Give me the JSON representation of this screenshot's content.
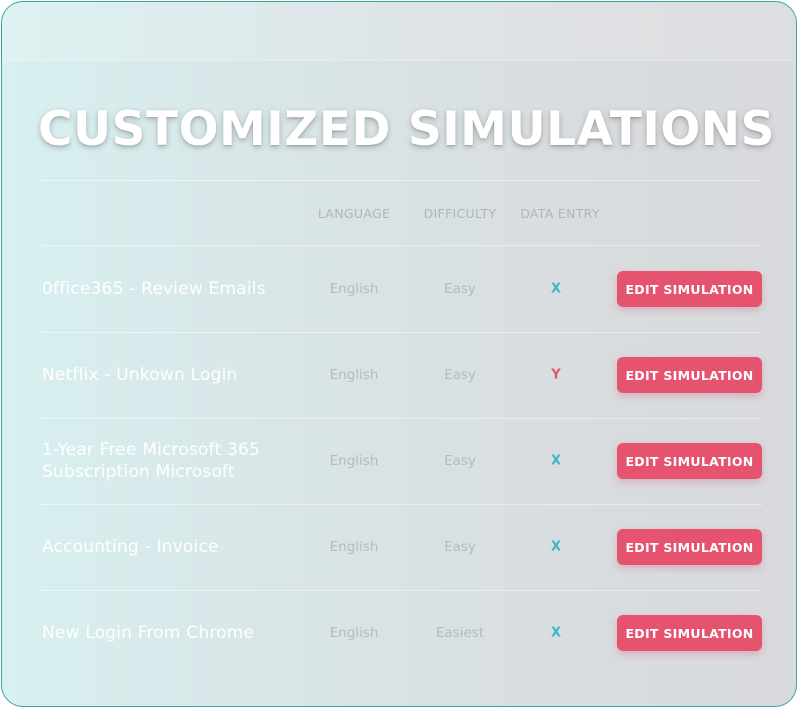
{
  "title": "CUSTOMIZED SIMULATIONS",
  "columns": {
    "language": "LANGUAGE",
    "difficulty": "DIFFICULTY",
    "data_entry": "DATA ENTRY"
  },
  "colors": {
    "accent_button": "#e5536f",
    "entry_x": "#3eb6c2",
    "entry_y": "#e2546e",
    "border": "#3aa6a4"
  },
  "rows": [
    {
      "name": "0ffice365 - Review Emails",
      "language": "English",
      "difficulty": "Easy",
      "data_entry": "X",
      "button": "EDIT SIMULATION"
    },
    {
      "name": "Netflix - Unkown Login",
      "language": "English",
      "difficulty": "Easy",
      "data_entry": "Y",
      "button": "EDIT SIMULATION"
    },
    {
      "name": "1-Year Free Microsoft 365 Subscription Microsoft",
      "language": "English",
      "difficulty": "Easy",
      "data_entry": "X",
      "button": "EDIT SIMULATION"
    },
    {
      "name": "Accounting - Invoice",
      "language": "English",
      "difficulty": "Easy",
      "data_entry": "X",
      "button": "EDIT SIMULATION"
    },
    {
      "name": "New Login From Chrome",
      "language": "English",
      "difficulty": "Easiest",
      "data_entry": "X",
      "button": "EDIT SIMULATION"
    }
  ]
}
